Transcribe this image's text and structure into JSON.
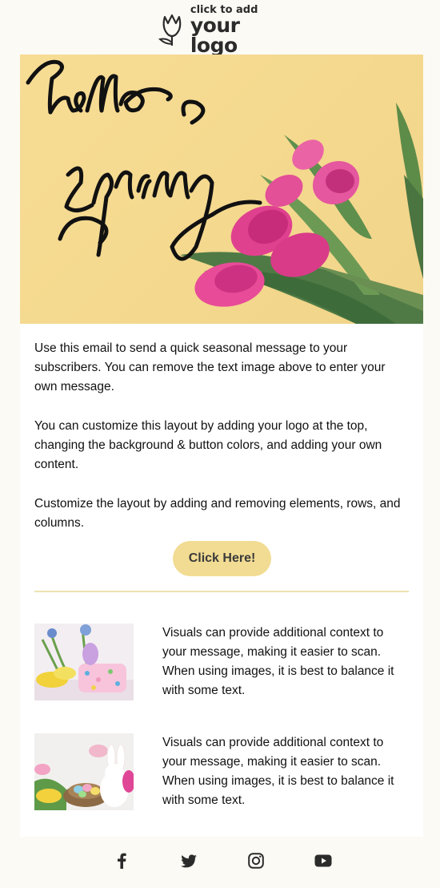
{
  "logo": {
    "line1": "click to add",
    "line2": "your logo",
    "icon": "tulip-icon"
  },
  "hero": {
    "script_line1": "hello",
    "script_line2": "spring",
    "background_color": "#f6da92",
    "flower_color": "#e0418f"
  },
  "body": {
    "paragraphs": [
      "Use this email to send a quick seasonal message to your subscribers. You can remove the text image above to enter your own message.",
      "You can customize this layout by adding your logo at the top, changing the background & button colors, and adding your own content.",
      "Customize the layout by adding and removing elements, rows, and columns."
    ],
    "cta_label": "Click Here!",
    "cta_color": "#f2dc93"
  },
  "features": [
    {
      "image": "easter-flowers-photo",
      "text": "Visuals can provide additional context to your message, making it easier to scan. When using images, it is best to balance it with some text."
    },
    {
      "image": "easter-bunny-nest-photo",
      "text": "Visuals can provide additional context to your message, making it easier to scan. When using images, it is best to balance it with some text."
    }
  ],
  "social": [
    "facebook-icon",
    "twitter-icon",
    "instagram-icon",
    "youtube-icon"
  ]
}
